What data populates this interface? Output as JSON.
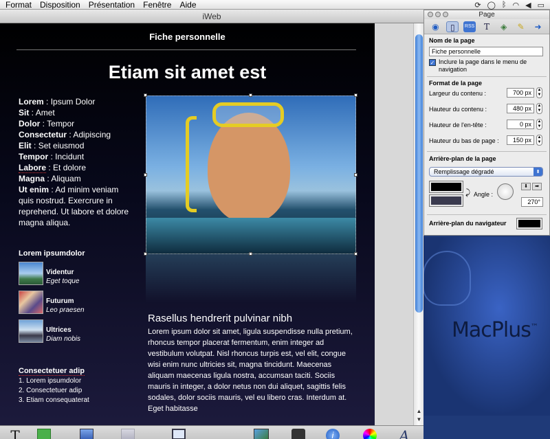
{
  "menubar": {
    "menus": [
      "Format",
      "Disposition",
      "Présentation",
      "Fenêtre",
      "Aide"
    ]
  },
  "window": {
    "title": "iWeb"
  },
  "page": {
    "heading": "Fiche personnelle",
    "title": "Etiam sit amet est",
    "profile": [
      {
        "key": "Lorem",
        "value": "Ipsum Dolor"
      },
      {
        "key": "Sit",
        "value": "Amet"
      },
      {
        "key": "Dolor",
        "value": "Tempor"
      },
      {
        "key": "Consectetur",
        "value": "Adipiscing"
      },
      {
        "key": "Elit",
        "value": "Set eiusmod"
      },
      {
        "key": "Tempor",
        "value": "Incidunt"
      },
      {
        "key": "Labore",
        "value": "Et dolore"
      },
      {
        "key": "Magna",
        "value": "Aliquam"
      },
      {
        "key": "Ut enim",
        "value": "Ad minim veniam quis nostrud. Exercrure in reprehend. Ut labore et dolore magna aliqua."
      }
    ],
    "links_heading": "Lorem ipsumdolor",
    "links": [
      {
        "title": "Videntur",
        "subtitle": "Eget toque"
      },
      {
        "title": "Futurum",
        "subtitle": "Leo praesen"
      },
      {
        "title": "Ultrices",
        "subtitle": "Diam nobis"
      }
    ],
    "list_heading": "Consectetuer adip",
    "list_items": [
      "1. Lorem ipsumdolor",
      "2. Consectetuer adip",
      "3. Etiam consequaterat"
    ],
    "article_title": "Rasellus hendrerit pulvinar nibh",
    "article_body": "Lorem ipsum dolor sit amet, ligula suspendisse nulla pretium, rhoncus tempor placerat fermentum, enim integer ad vestibulum volutpat. Nisl rhoncus turpis est, vel elit, congue wisi enim nunc ultricies sit, magna tincidunt. Maecenas aliquam maecenas ligula nostra, accumsan taciti. Sociis mauris in integer, a dolor netus non dui aliquet, sagittis felis sodales, dolor sociis mauris, vel eu libero cras. Interdum at. Eget habitasse"
  },
  "inspector": {
    "title": "Page",
    "page_name_label": "Nom de la page",
    "page_name_value": "Fiche personnelle",
    "include_menu_label": "Inclure la page dans le menu de navigation",
    "include_menu_checked": true,
    "format_label": "Format de la page",
    "content_width_label": "Largeur du contenu :",
    "content_width_value": "700 px",
    "content_height_label": "Hauteur du contenu :",
    "content_height_value": "480 px",
    "header_height_label": "Hauteur de l'en-tête :",
    "header_height_value": "0 px",
    "footer_height_label": "Hauteur du bas de page :",
    "footer_height_value": "150 px",
    "background_label": "Arrière-plan de la page",
    "fill_type": "Remplissage dégradé",
    "angle_label": "Angle :",
    "angle_value": "270°",
    "browser_bg_label": "Arrière-plan du navigateur",
    "colors": {
      "gradient_top": "#000000",
      "gradient_bottom": "#3a3a4e",
      "browser_bg": "#000000"
    }
  },
  "desktop": {
    "brand": "MacPlus"
  },
  "colors": {
    "accent": "#3f74d1",
    "page_bg": "#000000"
  }
}
